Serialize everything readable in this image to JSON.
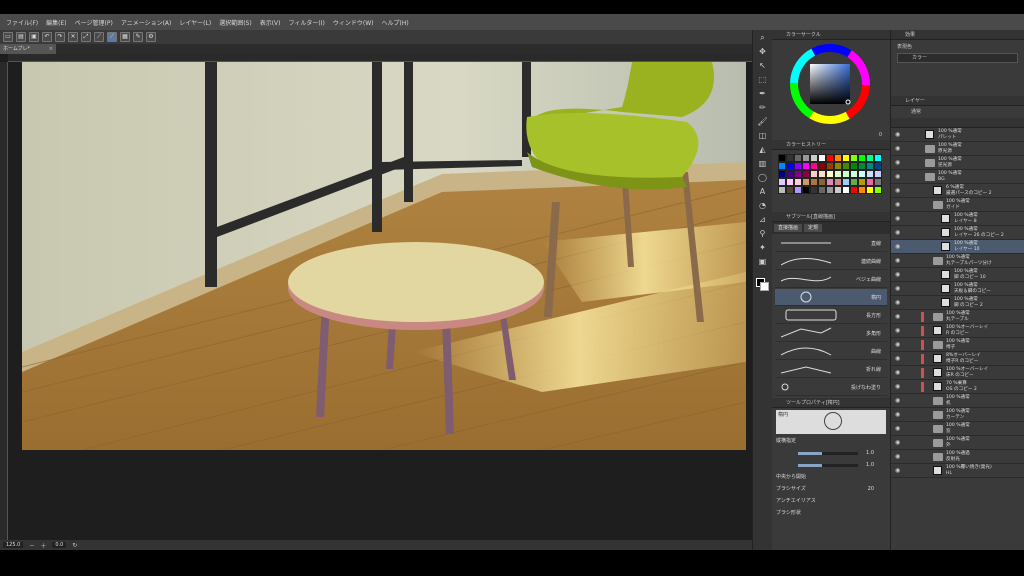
{
  "menu": [
    "ファイル(F)",
    "編集(E)",
    "ページ管理(P)",
    "アニメーション(A)",
    "レイヤー(L)",
    "選択範囲(S)",
    "表示(V)",
    "フィルター(I)",
    "ウィンドウ(W)",
    "ヘルプ(H)"
  ],
  "canvas": {
    "tab_label": "ホームブレ*",
    "zoom": "125.0",
    "angle": "0.0"
  },
  "color_panel": {
    "title": "カラーサークル",
    "value": "0"
  },
  "palette_panel": {
    "title": "カラーヒストリー"
  },
  "subtool": {
    "title": "サブツール[直線描画]",
    "tabs": [
      "直接描画",
      "定規"
    ],
    "items": [
      "直線",
      "連続曲線",
      "ベジェ曲線",
      "楕円",
      "長方形",
      "多角形",
      "曲線",
      "折れ線",
      "投げなわ塗り"
    ]
  },
  "toolprop": {
    "title": "ツールプロパティ[楕円]",
    "preview_label": "楕円",
    "rows": [
      {
        "label": "縦横指定",
        "value": ""
      },
      {
        "label": "",
        "value": "1.0"
      },
      {
        "label": "",
        "value": "1.0"
      },
      {
        "label": "中央から開始",
        "value": ""
      },
      {
        "label": "ブラシサイズ",
        "value": "20"
      },
      {
        "label": "アンチエイリアス",
        "value": ""
      },
      {
        "label": "ブラシ形状",
        "value": ""
      }
    ]
  },
  "effect_panel": {
    "title": "効果",
    "label": "表現色",
    "value": "カラー"
  },
  "layer_panel": {
    "title": "レイヤー",
    "blend": "通常",
    "layers": [
      {
        "pct": "100 %通常",
        "name": "パレット",
        "folder": false,
        "indent": 0,
        "sel": false,
        "red": false
      },
      {
        "pct": "100 %通常",
        "name": "原光源",
        "folder": true,
        "indent": 0,
        "sel": false,
        "red": false
      },
      {
        "pct": "100 %通常",
        "name": "逆光源",
        "folder": true,
        "indent": 0,
        "sel": false,
        "red": false
      },
      {
        "pct": "100 %通常",
        "name": "BG",
        "folder": true,
        "indent": 0,
        "sel": false,
        "red": false
      },
      {
        "pct": "6 %通常",
        "name": "厳選パースのコピー 2",
        "folder": false,
        "indent": 1,
        "sel": false,
        "red": false
      },
      {
        "pct": "100 %通常",
        "name": "ガイド",
        "folder": true,
        "indent": 1,
        "sel": false,
        "red": false
      },
      {
        "pct": "100 %通常",
        "name": "レイヤー 8",
        "folder": false,
        "indent": 2,
        "sel": false,
        "red": false
      },
      {
        "pct": "100 %通常",
        "name": "レイヤー 26 のコピー 2",
        "folder": false,
        "indent": 2,
        "sel": false,
        "red": false
      },
      {
        "pct": "100 %通常",
        "name": "レイヤー 10",
        "folder": false,
        "indent": 2,
        "sel": true,
        "red": false
      },
      {
        "pct": "100 %通常",
        "name": "丸テーブルパーツ分け",
        "folder": true,
        "indent": 1,
        "sel": false,
        "red": false
      },
      {
        "pct": "100 %通常",
        "name": "脚 のコピー 10",
        "folder": false,
        "indent": 2,
        "sel": false,
        "red": false
      },
      {
        "pct": "100 %通常",
        "name": "天板＆脚のコピー",
        "folder": false,
        "indent": 2,
        "sel": false,
        "red": false
      },
      {
        "pct": "100 %通常",
        "name": "脚 のコピー 2",
        "folder": false,
        "indent": 2,
        "sel": false,
        "red": false
      },
      {
        "pct": "100 %通常",
        "name": "丸テーブル",
        "folder": true,
        "indent": 1,
        "sel": false,
        "red": true
      },
      {
        "pct": "100 %オーバーレイ",
        "name": "R のコピー",
        "folder": false,
        "indent": 1,
        "sel": false,
        "red": true
      },
      {
        "pct": "100 %通常",
        "name": "椅子",
        "folder": true,
        "indent": 1,
        "sel": false,
        "red": true
      },
      {
        "pct": "8%オーバーレイ",
        "name": "椅子R のコピー",
        "folder": false,
        "indent": 1,
        "sel": false,
        "red": true
      },
      {
        "pct": "100 %オーバーレイ",
        "name": "床R のコピー",
        "folder": false,
        "indent": 1,
        "sel": false,
        "red": true
      },
      {
        "pct": "70 %乗算",
        "name": "OS のコピー 2",
        "folder": false,
        "indent": 1,
        "sel": false,
        "red": true
      },
      {
        "pct": "100 %通常",
        "name": "机",
        "folder": true,
        "indent": 1,
        "sel": false,
        "red": false
      },
      {
        "pct": "100 %通常",
        "name": "カーテン",
        "folder": true,
        "indent": 1,
        "sel": false,
        "red": false
      },
      {
        "pct": "100 %通常",
        "name": "窓",
        "folder": true,
        "indent": 1,
        "sel": false,
        "red": false
      },
      {
        "pct": "100 %通常",
        "name": "外",
        "folder": true,
        "indent": 1,
        "sel": false,
        "red": false
      },
      {
        "pct": "100 %通過",
        "name": "反射光",
        "folder": true,
        "indent": 1,
        "sel": false,
        "red": false
      },
      {
        "pct": "100 %覆い焼き(発光)",
        "name": "HL",
        "folder": false,
        "indent": 1,
        "sel": false,
        "red": false
      }
    ]
  }
}
